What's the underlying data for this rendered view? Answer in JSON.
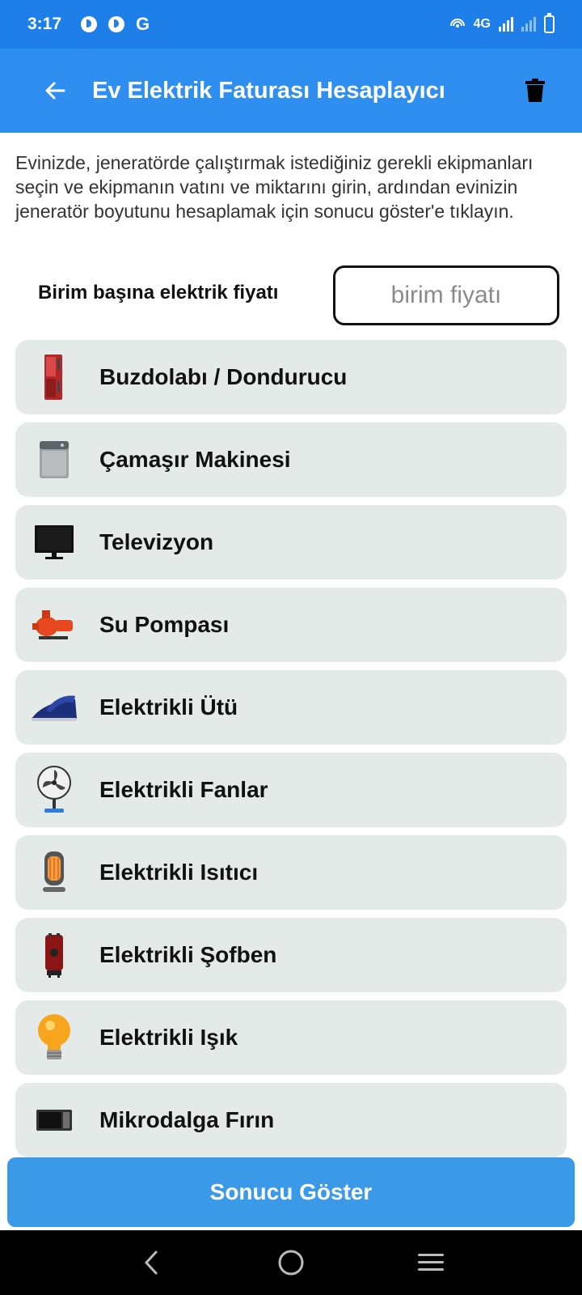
{
  "status_bar": {
    "time": "3:17",
    "g_label": "G",
    "network": "4G"
  },
  "app_bar": {
    "title": "Ev Elektrik Faturası Hesaplayıcı",
    "back_icon": "arrow-left-icon",
    "trash_icon": "trash-icon"
  },
  "intro_text": "Evinizde, jeneratörde çalıştırmak istediğiniz gerekli ekipmanları seçin ve ekipmanın vatını ve miktarını girin, ardından evinizin jeneratör boyutunu hesaplamak için sonucu göster'e tıklayın.",
  "price": {
    "label": "Birim başına elektrik fiyatı",
    "placeholder": "birim fiyatı",
    "value": ""
  },
  "appliances": [
    {
      "label": "Buzdolabı / Dondurucu",
      "icon": "fridge-icon"
    },
    {
      "label": "Çamaşır Makinesi",
      "icon": "washing-machine-icon"
    },
    {
      "label": "Televizyon",
      "icon": "tv-icon"
    },
    {
      "label": "Su Pompası",
      "icon": "water-pump-icon"
    },
    {
      "label": "Elektrikli Ütü",
      "icon": "iron-icon"
    },
    {
      "label": "Elektrikli Fanlar",
      "icon": "fan-icon"
    },
    {
      "label": "Elektrikli Isıtıcı",
      "icon": "heater-icon"
    },
    {
      "label": "Elektrikli Şofben",
      "icon": "water-heater-icon"
    },
    {
      "label": "Elektrikli Işık",
      "icon": "light-bulb-icon"
    },
    {
      "label": "Mikrodalga Fırın",
      "icon": "microwave-icon"
    }
  ],
  "result_button": {
    "label": "Sonucu Göster"
  },
  "colors": {
    "status_bar": "#1f7fe8",
    "app_bar": "#2e8ff0",
    "list_item_bg": "#e4eae7",
    "button": "#3a9ae8"
  }
}
